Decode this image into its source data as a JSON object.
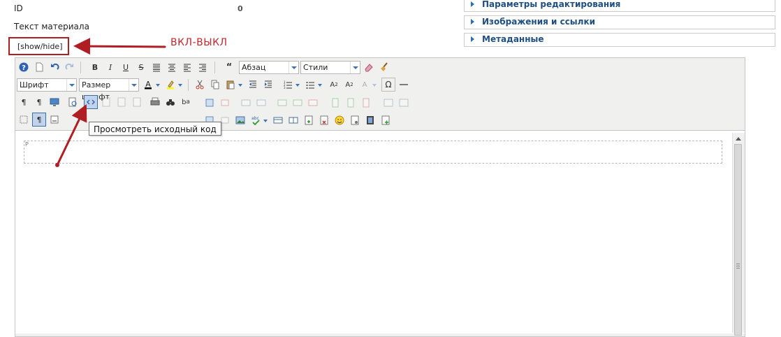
{
  "fields": {
    "id_label": "ID",
    "id_value": "0",
    "text_label": "Текст материала",
    "showhide_link": "[show/hide]"
  },
  "annotation": {
    "text": "ВКЛ-ВЫКЛ",
    "color": "#c4262c"
  },
  "right_panels": [
    {
      "label": "Параметры редактирования"
    },
    {
      "label": "Изображения и ссылки"
    },
    {
      "label": "Метаданные"
    }
  ],
  "toolbar": {
    "format_select": "Абзац",
    "styles_select": "Стили",
    "font_select": "Шрифт",
    "fontsize_select": "Размер шрифт"
  },
  "tooltip": {
    "text": "Просмотреть исходный код"
  },
  "editor": {
    "block_tag": "P"
  },
  "colors": {
    "accent": "#2b6faf",
    "panel_text": "#1f4f82",
    "annotation_red": "#c4262c"
  }
}
